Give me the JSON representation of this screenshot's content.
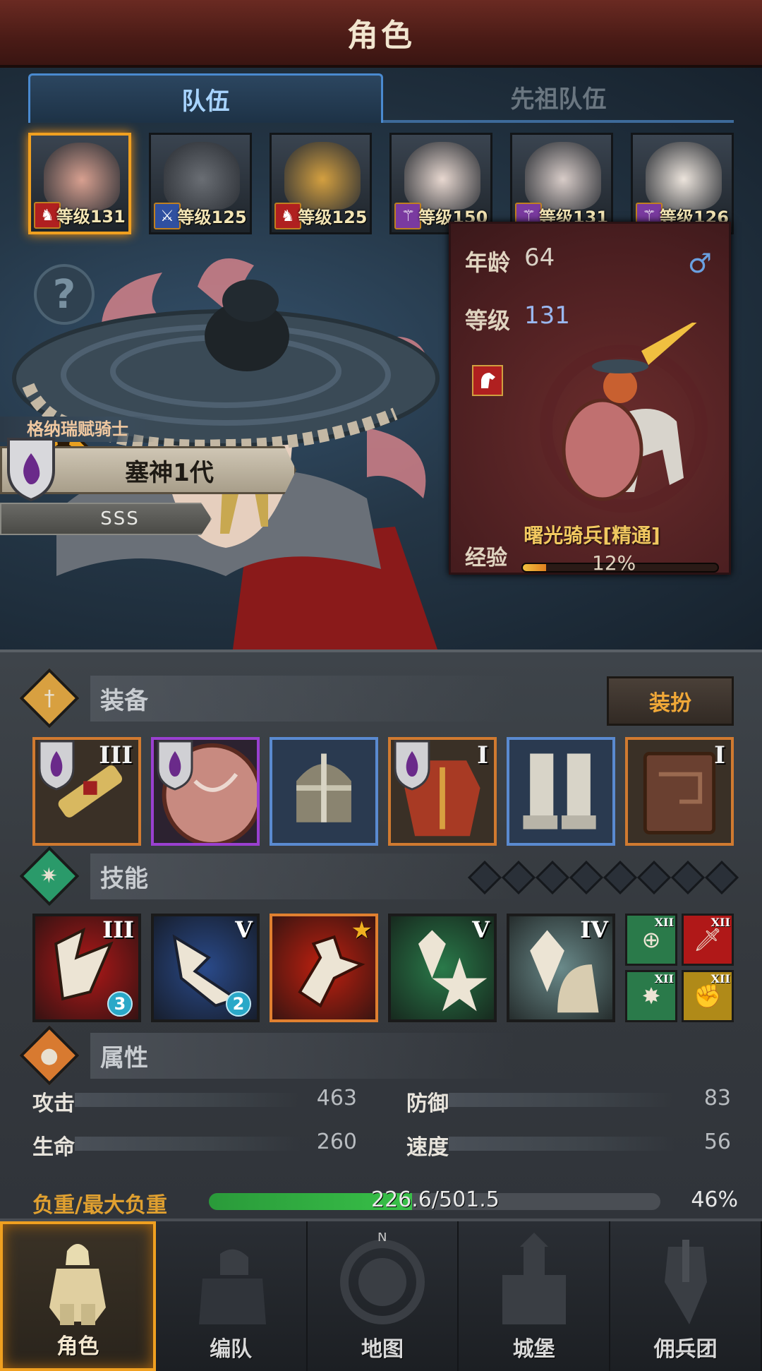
{
  "header": {
    "title": "角色"
  },
  "tabs": [
    {
      "label": "队伍",
      "active": true
    },
    {
      "label": "先祖队伍",
      "active": false
    }
  ],
  "roster": [
    {
      "level": "等级131",
      "class_icon": "horse-icon",
      "class_color": "#b02020",
      "selected": true
    },
    {
      "level": "等级125",
      "class_icon": "sword-icon",
      "class_color": "#3050a0",
      "selected": false
    },
    {
      "level": "等级125",
      "class_icon": "horse-icon",
      "class_color": "#b02020",
      "selected": false
    },
    {
      "level": "等级150",
      "class_icon": "staff-icon",
      "class_color": "#7a3aa0",
      "selected": false
    },
    {
      "level": "等级131",
      "class_icon": "staff-icon",
      "class_color": "#7a3aa0",
      "selected": false
    },
    {
      "level": "等级126",
      "class_icon": "staff-icon",
      "class_color": "#7a3aa0",
      "selected": false
    }
  ],
  "hero": {
    "title": "格纳瑞赋骑士",
    "name": "塞神1代",
    "rank": "SSS"
  },
  "info": {
    "age_label": "年龄",
    "age_value": "64",
    "level_label": "等级",
    "level_value": "131",
    "gender_symbol": "♂",
    "unit_name": "曙光骑兵[精通]",
    "xp_label": "经验",
    "xp_text": "12%",
    "xp_fraction": 0.12
  },
  "equipment": {
    "label": "装备",
    "dress_button": "装扮",
    "slots": [
      {
        "name": "weapon",
        "tier": "III",
        "rarity": "legendary",
        "banner": true
      },
      {
        "name": "shield",
        "tier": "",
        "rarity": "epic",
        "banner": true
      },
      {
        "name": "helmet",
        "tier": "",
        "rarity": "rare",
        "banner": false
      },
      {
        "name": "armor",
        "tier": "I",
        "rarity": "legendary",
        "banner": true
      },
      {
        "name": "boots",
        "tier": "",
        "rarity": "rare",
        "banner": false
      },
      {
        "name": "book",
        "tier": "I",
        "rarity": "legendary",
        "banner": false
      }
    ]
  },
  "skills": {
    "label": "技能",
    "slots": [
      {
        "name": "charge-strike",
        "tier": "III",
        "count": "3",
        "bg": "#b01818"
      },
      {
        "name": "shield-bash",
        "tier": "V",
        "count": "2",
        "bg": "#2a4a8a"
      },
      {
        "name": "knight-rush",
        "tier": "",
        "count": "",
        "bg": "#c02010"
      },
      {
        "name": "crystal-burst",
        "tier": "V",
        "count": "",
        "bg": "#2a7a4a"
      },
      {
        "name": "crystal-guard",
        "tier": "IV",
        "count": "",
        "bg": "#6a8a8a"
      }
    ],
    "mini": [
      {
        "tier": "XII",
        "icon": "target-icon",
        "bg": "#2a7a4a"
      },
      {
        "tier": "XII",
        "icon": "sword-icon",
        "bg": "#b01818"
      },
      {
        "tier": "XII",
        "icon": "burst-icon",
        "bg": "#2a7a4a"
      },
      {
        "tier": "XII",
        "icon": "gauntlet-icon",
        "bg": "#b08a18"
      }
    ]
  },
  "attributes": {
    "label": "属性",
    "stats": [
      {
        "name": "攻击",
        "value": "463"
      },
      {
        "name": "防御",
        "value": "83"
      },
      {
        "name": "生命",
        "value": "260"
      },
      {
        "name": "速度",
        "value": "56"
      }
    ],
    "load_label": "负重/最大负重",
    "load_value": "226.6/501.5",
    "load_pct": "46%",
    "load_fraction": 0.45
  },
  "nav": [
    {
      "label": "角色",
      "icon": "knight-icon",
      "active": true
    },
    {
      "label": "编队",
      "icon": "squad-icon",
      "active": false
    },
    {
      "label": "地图",
      "icon": "compass-map-icon",
      "active": false
    },
    {
      "label": "城堡",
      "icon": "castle-icon",
      "active": false
    },
    {
      "label": "佣兵团",
      "icon": "mercenary-icon",
      "active": false
    }
  ]
}
